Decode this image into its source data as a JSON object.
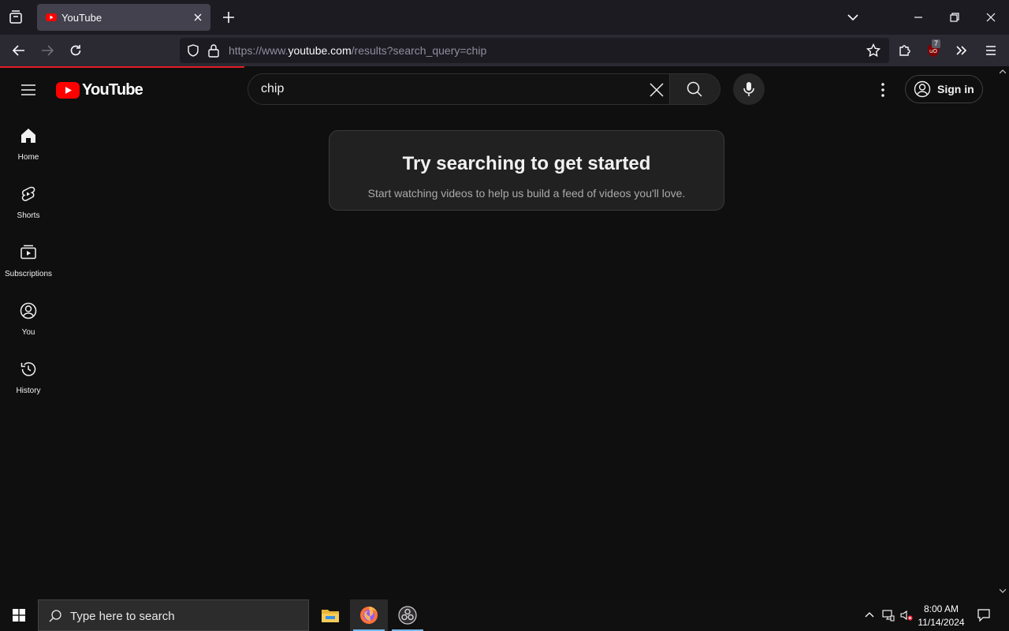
{
  "browser": {
    "tab_title": "YouTube",
    "url_prefix": "https://www.",
    "url_host": "youtube.com",
    "url_path": "/results?search_query=chip",
    "extension_badge": "7"
  },
  "header": {
    "logo_text": "YouTube",
    "search_value": "chip",
    "signin_label": "Sign in"
  },
  "sidebar": {
    "items": [
      {
        "label": "Home",
        "icon": "home-icon"
      },
      {
        "label": "Shorts",
        "icon": "shorts-icon"
      },
      {
        "label": "Subscriptions",
        "icon": "subscriptions-icon"
      },
      {
        "label": "You",
        "icon": "you-icon"
      },
      {
        "label": "History",
        "icon": "history-icon"
      }
    ]
  },
  "main": {
    "card_title": "Try searching to get started",
    "card_subtitle": "Start watching videos to help us build a feed of videos you'll love."
  },
  "taskbar": {
    "search_placeholder": "Type here to search",
    "time": "8:00 AM",
    "date": "11/14/2024"
  },
  "colors": {
    "brand_red": "#ff0000",
    "background": "#0f0f0f",
    "progress_red": "#e31b23"
  }
}
